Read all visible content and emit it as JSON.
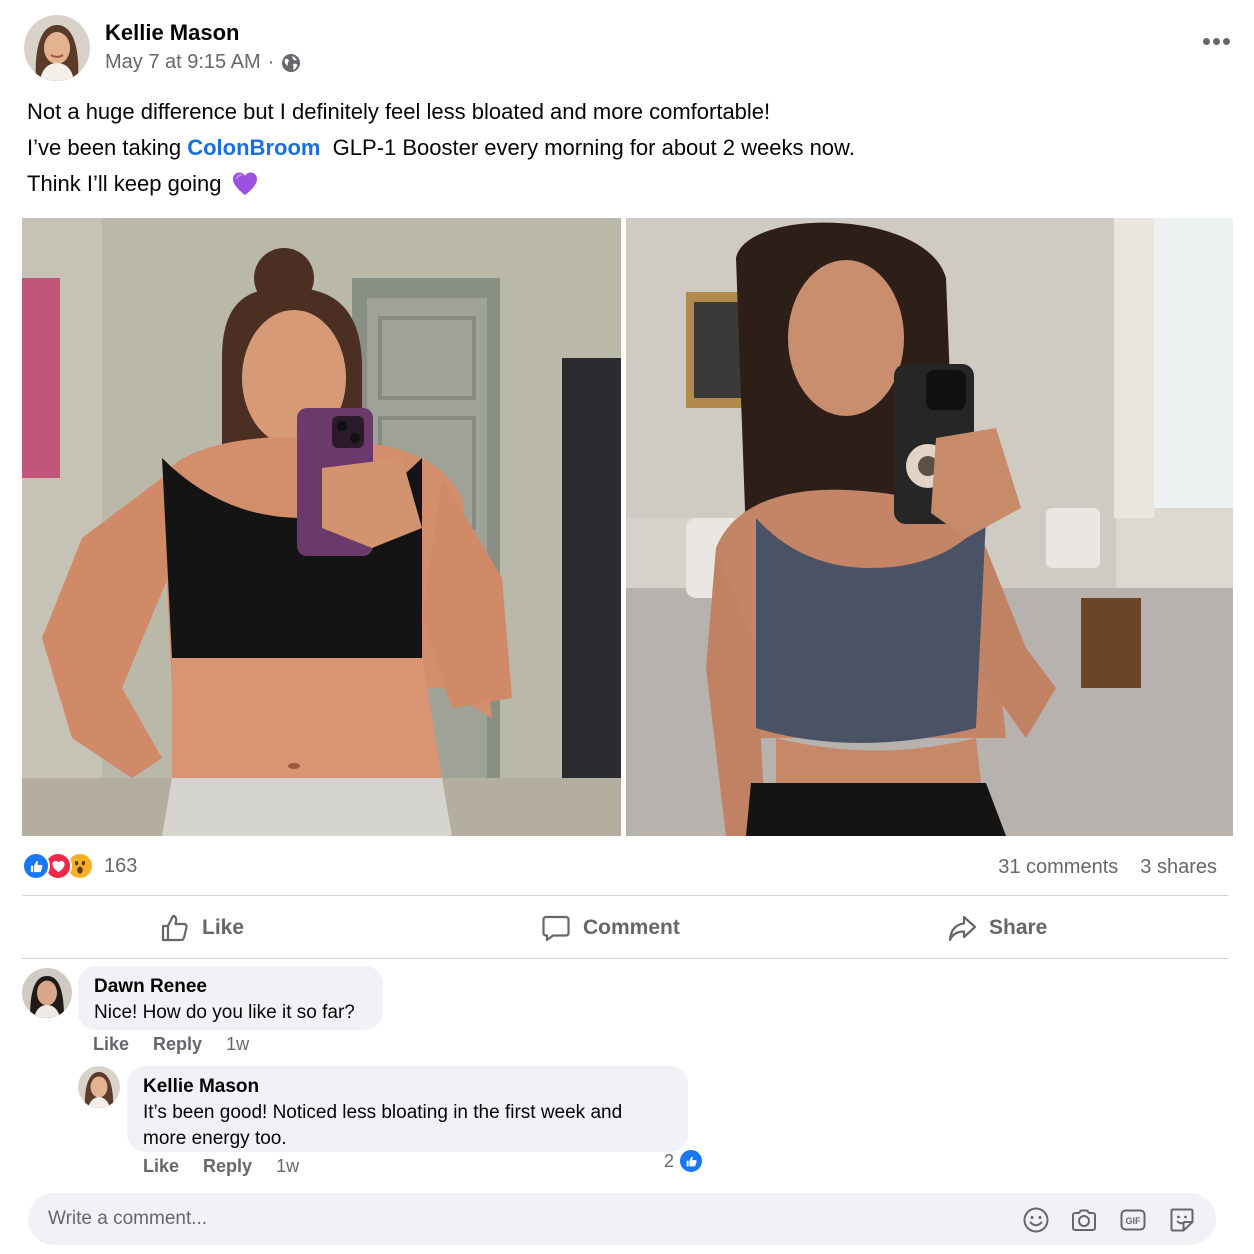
{
  "post": {
    "author": "Kellie Mason",
    "timestamp": "May 7 at 9:15 AM",
    "separator": "·",
    "audience_icon": "globe-icon",
    "more_icon": "more-options-icon",
    "text": {
      "line1": "Not a huge difference but I definitely feel less bloated and more comfortable!",
      "line2_prefix": "I’ve been taking",
      "line2_link": "ColonBroom",
      "line2_suffix": "GLP-1 Booster every morning for about 2 weeks now.",
      "line3": "Think I’ll keep going",
      "emoji": "purple-heart-emoji"
    },
    "photos": [
      "before-mirror-selfie",
      "after-mirror-selfie"
    ]
  },
  "engagement": {
    "reaction_icons": [
      "like-reaction-icon",
      "love-reaction-icon",
      "wow-reaction-icon"
    ],
    "reaction_count": "163",
    "comments": "31 comments",
    "shares": "3 shares"
  },
  "actions": {
    "like": "Like",
    "comment": "Comment",
    "share": "Share"
  },
  "comments": [
    {
      "author": "Dawn Renee",
      "text": "Nice! How do you like it so far?",
      "like": "Like",
      "reply": "Reply",
      "time": "1w"
    },
    {
      "author": "Kellie Mason",
      "text_line1": "It’s been good! Noticed less bloating in the first week and",
      "text_line2": "more energy too.",
      "like": "Like",
      "reply": "Reply",
      "time": "1w",
      "like_count": "2"
    }
  ],
  "composer": {
    "placeholder": "Write a comment...",
    "icons": [
      "emoji-icon",
      "camera-icon",
      "gif-icon",
      "sticker-icon"
    ]
  },
  "colors": {
    "link": "#1a6fe0",
    "facebook_blue": "#1877f2",
    "secondary_text": "#65676b",
    "bubble": "#f0f2f5"
  }
}
